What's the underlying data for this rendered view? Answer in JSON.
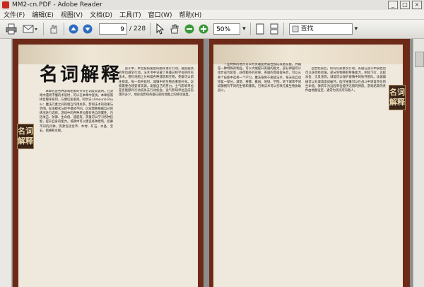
{
  "window": {
    "title": "MM2-cn.PDF - Adobe Reader"
  },
  "menu": {
    "items": [
      "文件(F)",
      "编辑(E)",
      "视图(V)",
      "文档(D)",
      "工具(T)",
      "窗口(W)",
      "帮助(H)"
    ]
  },
  "toolbar": {
    "page_current": "9",
    "page_total": "/ 228",
    "zoom": "50%",
    "search_placeholder": "查找"
  },
  "doc": {
    "left": {
      "heading": "名词解释",
      "tag": "名词解释",
      "col1": "本章包含各种游戏相关的专有名词及其说明。在游戏中遇到不懂的术语时，可以在本章中查找。本章按照拼音顺序排列，方便玩家查阅。阿尔沃 (Amouria Roya)：魔法元素之间的相互作用关系，影响法术的效果与范围。标准模式与新手模式不同，玩家需要根据自己的情况进行选择。游戏中的各种单位都有各自的属性，包括攻击、防御、生命值、速度等。英雄可以学习各种技能，提升自身的能力。城镇中可以建造各种建筑，招募不同的兵种。资源包括金币、木材、矿石、水晶、宝石、硫磺和水银。",
      "col2": "战斗中，单位按照速度的顺序进行行动。速度越高的单位越早行动。法术书中记载了英雄已经学会的所有法术。冒险地图上分布着各种建筑和宝物，英雄可以前往探索。每一周开始时，城镇中的生物会重新补充。玩家需要合理安排资源，发展自己的势力。士气影响单位是否能额外行动或失去行动机会。运气影响单位造成伤害的多少。地形会影响英雄在冒险地图上的移动速度。"
    },
    "right": {
      "tag": "名词解释",
      "col1": "一些特殊的地点可以为英雄提供属性加成或者技能。神器是一种特殊的物品，可以大幅提升英雄的能力。部分神器可以组合成为套装，获得额外的效果。英雄的等级提升后，可以从两个技能中选择一个学习。魔法值用于施放法术，每天会自动恢复一部分。城堡、要塞、墓园、地狱、学院、地下城等不同城镇拥有不同的生物和建筑。召唤法术可以召唤元素生物协助战斗。",
      "col2": "回合结束后，所有玩家依次行动。英雄在战斗中获胜后可以获得经验值。部分生物拥有特殊能力，例如飞行、远程攻击、无反击等。城墙可以保护城镇中的防守部队。攻城器械可以对城墙造成破坏。医疗帐篷可以在战斗中恢复单位的生命值。弹药车为远程单位提供无限的弹药。游戏结束的条件由地图设定，通常为消灭所有敌人。"
    }
  },
  "icons": [
    "print-icon",
    "email-icon",
    "up-arrow-icon",
    "down-arrow-icon",
    "select-cursor-icon",
    "hand-icon",
    "zoom-out-icon",
    "zoom-in-icon",
    "single-page-icon",
    "scroll-page-icon",
    "search-icon"
  ],
  "colors": {
    "page_border": "#6e2a18",
    "page_paper": "#efe8dc",
    "viewport_bg": "#8d8d8d",
    "adobe_red": "#c8281e"
  }
}
